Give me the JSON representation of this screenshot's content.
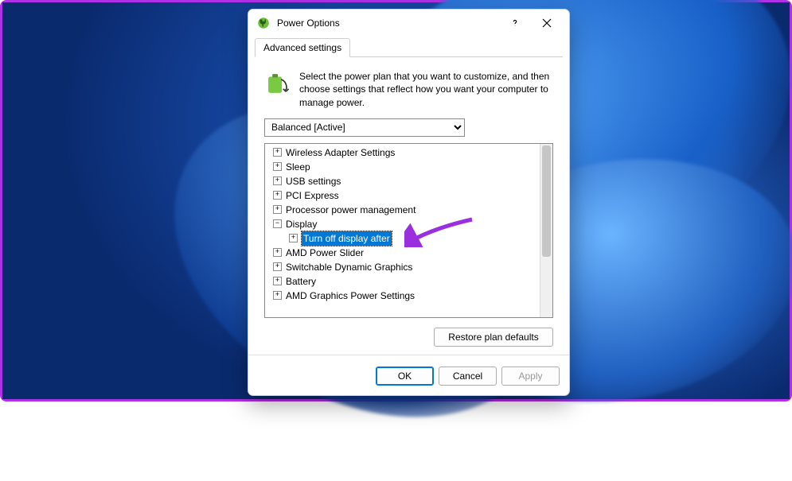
{
  "dialog": {
    "title": "Power Options",
    "tab": "Advanced settings",
    "instruction": "Select the power plan that you want to customize, and then choose settings that reflect how you want your computer to manage power.",
    "plan_selected": "Balanced [Active]",
    "tree": {
      "items": [
        {
          "label": "Wireless Adapter Settings",
          "expanded": false,
          "depth": 0
        },
        {
          "label": "Sleep",
          "expanded": false,
          "depth": 0
        },
        {
          "label": "USB settings",
          "expanded": false,
          "depth": 0
        },
        {
          "label": "PCI Express",
          "expanded": false,
          "depth": 0
        },
        {
          "label": "Processor power management",
          "expanded": false,
          "depth": 0
        },
        {
          "label": "Display",
          "expanded": true,
          "depth": 0
        },
        {
          "label": "Turn off display after",
          "expanded": false,
          "depth": 1,
          "selected": true
        },
        {
          "label": "AMD Power Slider",
          "expanded": false,
          "depth": 0
        },
        {
          "label": "Switchable Dynamic Graphics",
          "expanded": false,
          "depth": 0
        },
        {
          "label": "Battery",
          "expanded": false,
          "depth": 0
        },
        {
          "label": "AMD Graphics Power Settings",
          "expanded": false,
          "depth": 0
        }
      ]
    },
    "buttons": {
      "restore": "Restore plan defaults",
      "ok": "OK",
      "cancel": "Cancel",
      "apply": "Apply"
    }
  },
  "annotation": {
    "color": "#9a2fe0"
  }
}
